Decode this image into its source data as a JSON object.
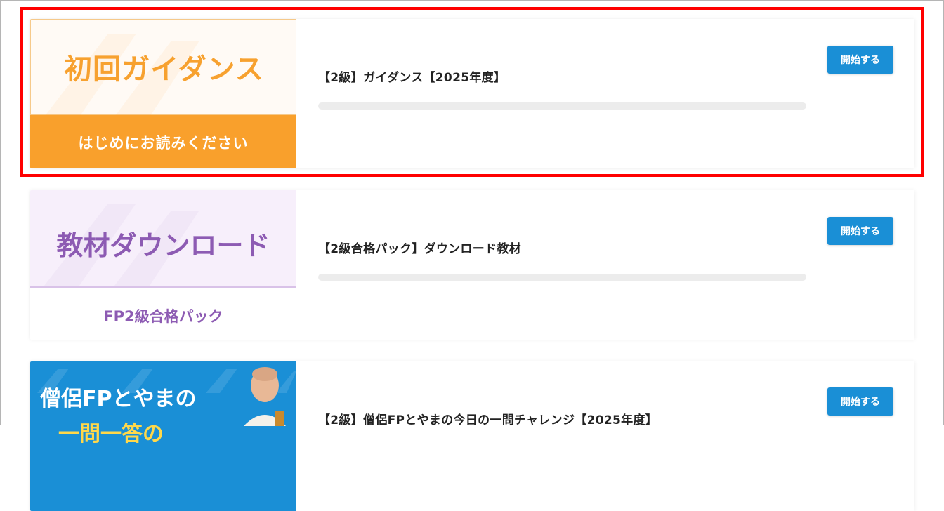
{
  "courses": [
    {
      "thumb_title": "初回ガイダンス",
      "thumb_subtitle": "はじめにお読みください",
      "title": "【2級】ガイダンス【2025年度】",
      "progress": 0,
      "button_label": "開始する",
      "highlighted": true,
      "accent_color": "#f7a12f"
    },
    {
      "thumb_title": "教材ダウンロード",
      "thumb_subtitle": "FP2級合格パック",
      "title": "【2級合格パック】ダウンロード教材",
      "progress": 0,
      "button_label": "開始する",
      "accent_color": "#8d5bb3"
    },
    {
      "thumb_title": "僧侶FPとやまの",
      "thumb_subtitle": "一問一答の",
      "title": "【2級】僧侶FPとやまの今日の一問チャレンジ【2025年度】",
      "progress": 0,
      "button_label": "開始する",
      "accent_color": "#1a8fd6"
    }
  ],
  "colors": {
    "highlight_border": "#ff0000",
    "button_bg": "#1a8fd6",
    "progress_track": "#ececec"
  }
}
